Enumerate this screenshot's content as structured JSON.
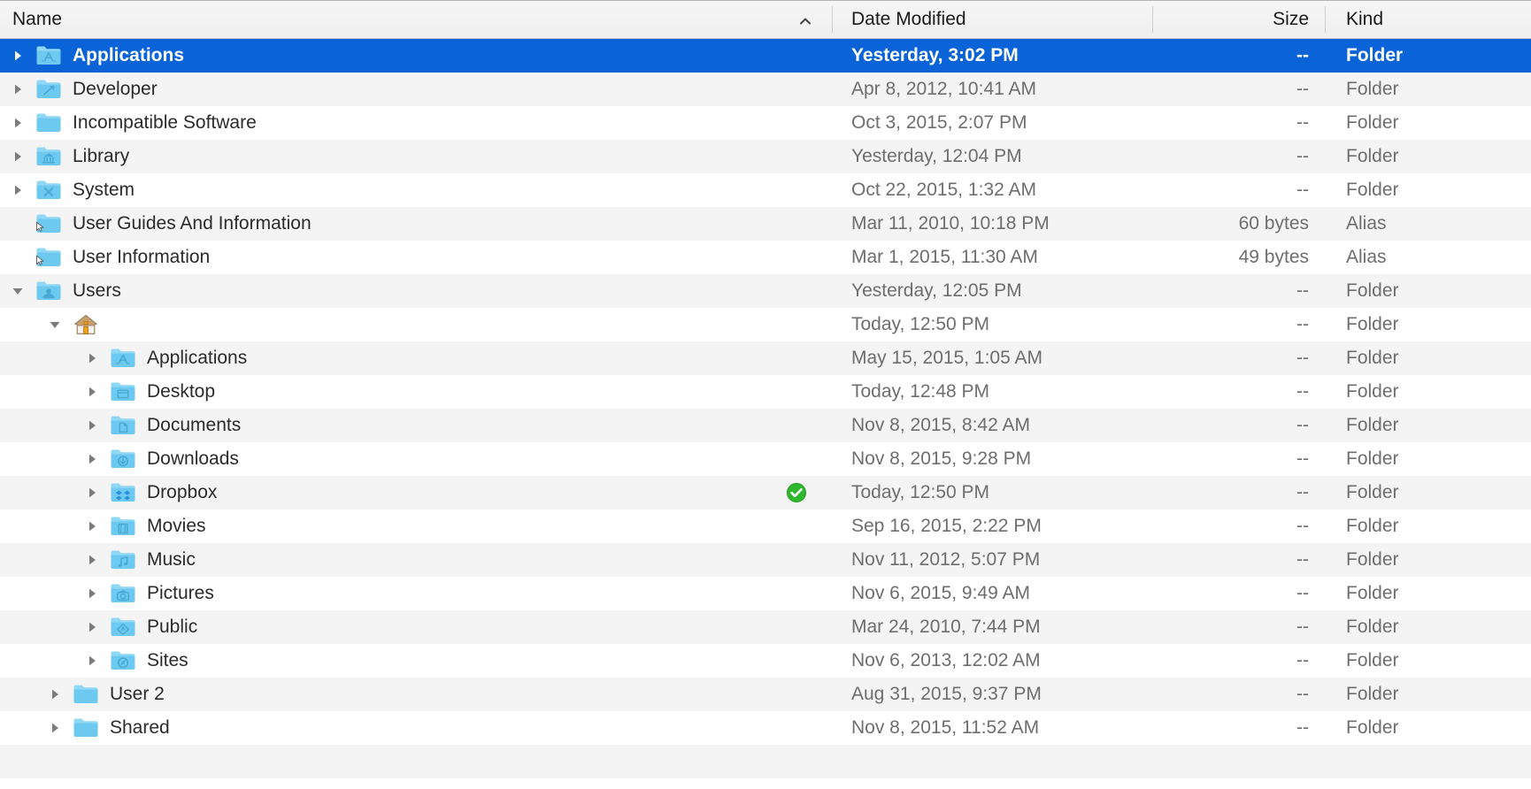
{
  "window": {
    "title": "Finder List View",
    "view_mode": "list"
  },
  "colors": {
    "selection_blue": "#0a63d7",
    "row_stripe": "#f4f4f4",
    "row_plain": "#ffffff",
    "header_bg": "#efefef",
    "folder_blue": "#6ec9f0",
    "sync_green": "#2eb82e",
    "secondary_text": "#6e6e6e"
  },
  "header": {
    "columns": [
      {
        "key": "name",
        "label": "Name",
        "align": "left",
        "sorted": true,
        "sort_direction": "ascending",
        "sort_icon": "chevron-up-icon"
      },
      {
        "key": "date_modified",
        "label": "Date Modified",
        "align": "left",
        "sorted": false
      },
      {
        "key": "size",
        "label": "Size",
        "align": "right",
        "sorted": false
      },
      {
        "key": "kind",
        "label": "Kind",
        "align": "left",
        "sorted": false
      }
    ]
  },
  "rows": [
    {
      "name": "Applications",
      "date_modified": "Yesterday, 3:02 PM",
      "size": "--",
      "kind": "Folder",
      "depth": 0,
      "disclosure": "collapsed",
      "icon": "folder-applications-icon",
      "selected": true,
      "sync_badge": null
    },
    {
      "name": "Developer",
      "date_modified": "Apr 8, 2012, 10:41 AM",
      "size": "--",
      "kind": "Folder",
      "depth": 0,
      "disclosure": "collapsed",
      "icon": "folder-developer-icon",
      "selected": false,
      "sync_badge": null
    },
    {
      "name": "Incompatible Software",
      "date_modified": "Oct 3, 2015, 2:07 PM",
      "size": "--",
      "kind": "Folder",
      "depth": 0,
      "disclosure": "collapsed",
      "icon": "folder-plain-icon",
      "selected": false,
      "sync_badge": null
    },
    {
      "name": "Library",
      "date_modified": "Yesterday, 12:04 PM",
      "size": "--",
      "kind": "Folder",
      "depth": 0,
      "disclosure": "collapsed",
      "icon": "folder-library-icon",
      "selected": false,
      "sync_badge": null
    },
    {
      "name": "System",
      "date_modified": "Oct 22, 2015, 1:32 AM",
      "size": "--",
      "kind": "Folder",
      "depth": 0,
      "disclosure": "collapsed",
      "icon": "folder-system-icon",
      "selected": false,
      "sync_badge": null
    },
    {
      "name": "User Guides And Information",
      "date_modified": "Mar 11, 2010, 10:18 PM",
      "size": "60 bytes",
      "kind": "Alias",
      "depth": 0,
      "disclosure": "none",
      "icon": "folder-alias-icon",
      "selected": false,
      "sync_badge": null
    },
    {
      "name": "User Information",
      "date_modified": "Mar 1, 2015, 11:30 AM",
      "size": "49 bytes",
      "kind": "Alias",
      "depth": 0,
      "disclosure": "none",
      "icon": "folder-alias-icon",
      "selected": false,
      "sync_badge": null
    },
    {
      "name": "Users",
      "date_modified": "Yesterday, 12:05 PM",
      "size": "--",
      "kind": "Folder",
      "depth": 0,
      "disclosure": "expanded",
      "icon": "folder-users-icon",
      "selected": false,
      "sync_badge": null
    },
    {
      "name": "",
      "date_modified": "Today, 12:50 PM",
      "size": "--",
      "kind": "Folder",
      "depth": 1,
      "disclosure": "expanded",
      "icon": "home-folder-icon",
      "selected": false,
      "sync_badge": null
    },
    {
      "name": "Applications",
      "date_modified": "May 15, 2015, 1:05 AM",
      "size": "--",
      "kind": "Folder",
      "depth": 2,
      "disclosure": "collapsed",
      "icon": "folder-applications-icon",
      "selected": false,
      "sync_badge": null
    },
    {
      "name": "Desktop",
      "date_modified": "Today, 12:48 PM",
      "size": "--",
      "kind": "Folder",
      "depth": 2,
      "disclosure": "collapsed",
      "icon": "folder-desktop-icon",
      "selected": false,
      "sync_badge": null
    },
    {
      "name": "Documents",
      "date_modified": "Nov 8, 2015, 8:42 AM",
      "size": "--",
      "kind": "Folder",
      "depth": 2,
      "disclosure": "collapsed",
      "icon": "folder-documents-icon",
      "selected": false,
      "sync_badge": null
    },
    {
      "name": "Downloads",
      "date_modified": "Nov 8, 2015, 9:28 PM",
      "size": "--",
      "kind": "Folder",
      "depth": 2,
      "disclosure": "collapsed",
      "icon": "folder-downloads-icon",
      "selected": false,
      "sync_badge": null
    },
    {
      "name": "Dropbox",
      "date_modified": "Today, 12:50 PM",
      "size": "--",
      "kind": "Folder",
      "depth": 2,
      "disclosure": "collapsed",
      "icon": "folder-dropbox-icon",
      "selected": false,
      "sync_badge": "sync-complete-check-icon"
    },
    {
      "name": "Movies",
      "date_modified": "Sep 16, 2015, 2:22 PM",
      "size": "--",
      "kind": "Folder",
      "depth": 2,
      "disclosure": "collapsed",
      "icon": "folder-movies-icon",
      "selected": false,
      "sync_badge": null
    },
    {
      "name": "Music",
      "date_modified": "Nov 11, 2012, 5:07 PM",
      "size": "--",
      "kind": "Folder",
      "depth": 2,
      "disclosure": "collapsed",
      "icon": "folder-music-icon",
      "selected": false,
      "sync_badge": null
    },
    {
      "name": "Pictures",
      "date_modified": "Nov 6, 2015, 9:49 AM",
      "size": "--",
      "kind": "Folder",
      "depth": 2,
      "disclosure": "collapsed",
      "icon": "folder-pictures-icon",
      "selected": false,
      "sync_badge": null
    },
    {
      "name": "Public",
      "date_modified": "Mar 24, 2010, 7:44 PM",
      "size": "--",
      "kind": "Folder",
      "depth": 2,
      "disclosure": "collapsed",
      "icon": "folder-public-icon",
      "selected": false,
      "sync_badge": null
    },
    {
      "name": "Sites",
      "date_modified": "Nov 6, 2013, 12:02 AM",
      "size": "--",
      "kind": "Folder",
      "depth": 2,
      "disclosure": "collapsed",
      "icon": "folder-sites-icon",
      "selected": false,
      "sync_badge": null
    },
    {
      "name": "User 2",
      "date_modified": "Aug 31, 2015, 9:37 PM",
      "size": "--",
      "kind": "Folder",
      "depth": 1,
      "disclosure": "collapsed",
      "icon": "folder-plain-icon",
      "selected": false,
      "sync_badge": null
    },
    {
      "name": "Shared",
      "date_modified": "Nov 8, 2015, 11:52 AM",
      "size": "--",
      "kind": "Folder",
      "depth": 1,
      "disclosure": "collapsed",
      "icon": "folder-plain-icon",
      "selected": false,
      "sync_badge": null
    }
  ]
}
